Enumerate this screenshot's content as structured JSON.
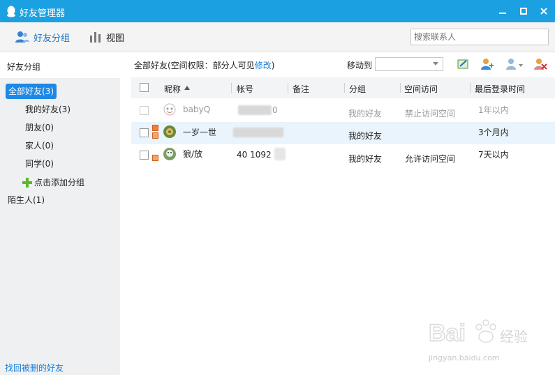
{
  "window": {
    "title": "好友管理器"
  },
  "toolbar": {
    "friends_tab": "好友分组",
    "view_tab": "视图",
    "search_placeholder": "搜索联系人"
  },
  "sidebar": {
    "header": "好友分组",
    "items": [
      {
        "label": "全部好友(3)"
      },
      {
        "label": "我的好友(3)"
      },
      {
        "label": "朋友(0)"
      },
      {
        "label": "家人(0)"
      },
      {
        "label": "同学(0)"
      },
      {
        "label": "点击添加分组"
      },
      {
        "label": "陌生人(1)"
      }
    ],
    "footer": "找回被删的好友"
  },
  "main": {
    "title_prefix": "全部好友(空间权限：部分人可见",
    "title_link": "修改",
    "title_suffix": ")",
    "move_to": "移动到",
    "columns": [
      "昵称",
      "帐号",
      "备注",
      "分组",
      "空间访问",
      "最后登录时间"
    ],
    "rows": [
      {
        "nick": "babyQ",
        "account_tail": "0",
        "group": "我的好友",
        "space": "禁止访问空间",
        "last": "1年以内"
      },
      {
        "nick": "一岁一世",
        "account_tail": "",
        "group": "我的好友",
        "space": "",
        "last": "3个月内"
      },
      {
        "nick": "狼/放",
        "account_tail": "40  1092",
        "group": "我的好友",
        "space": "允许访问空间",
        "last": "7天以内"
      }
    ]
  },
  "watermark": {
    "brand": "Bai du 经验",
    "url": "jingyan.baidu.com"
  },
  "colors": {
    "titlebar": "#1ba1e2",
    "accent": "#1e88e5",
    "link": "#1a7fd8"
  }
}
